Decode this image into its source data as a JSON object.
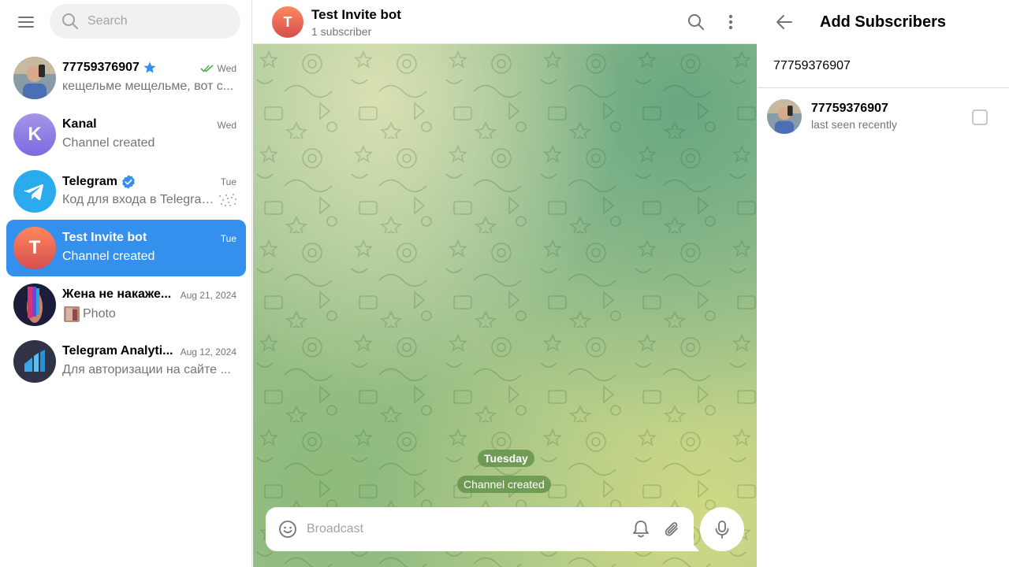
{
  "colors": {
    "accent": "#3390ec",
    "active_item_bg": "#3390ec",
    "secondary_text": "#707579",
    "read_check": "#4fae4e",
    "verified": "#3390ec",
    "service_pill_bg": "#5c8c46"
  },
  "sidebar": {
    "menu_icon": "hamburger-menu-icon",
    "search_placeholder": "Search",
    "chats": [
      {
        "name": "77759376907",
        "badge_icon": "star-icon",
        "date": "Wed",
        "status_icon": "double-check-icon",
        "preview": "кещельме мещельме, вот с...",
        "active": false
      },
      {
        "name": "Kanal",
        "avatar_letter": "K",
        "date": "Wed",
        "preview": "Channel created",
        "active": false
      },
      {
        "name": "Telegram",
        "badge_icon": "verified-icon",
        "date": "Tue",
        "preview": "Код для входа в Telegram:",
        "active": false
      },
      {
        "name": "Test Invite bot",
        "avatar_letter": "T",
        "date": "Tue",
        "preview": "Channel created",
        "active": true
      },
      {
        "name": "Жена не накаже...",
        "date": "Aug 21, 2024",
        "preview": "Photo",
        "active": false
      },
      {
        "name": "Telegram Analyti...",
        "date": "Aug 12, 2024",
        "preview": "Для авторизации на сайте ...",
        "active": false
      }
    ]
  },
  "chat": {
    "avatar_letter": "T",
    "title": "Test Invite bot",
    "subtitle": "1 subscriber",
    "date_separator": "Tuesday",
    "service_message": "Channel created",
    "composer_placeholder": "Broadcast"
  },
  "right_panel": {
    "title": "Add Subscribers",
    "search_value": "77759376907",
    "contacts": [
      {
        "name": "77759376907",
        "status": "last seen recently",
        "checked": false
      }
    ]
  }
}
